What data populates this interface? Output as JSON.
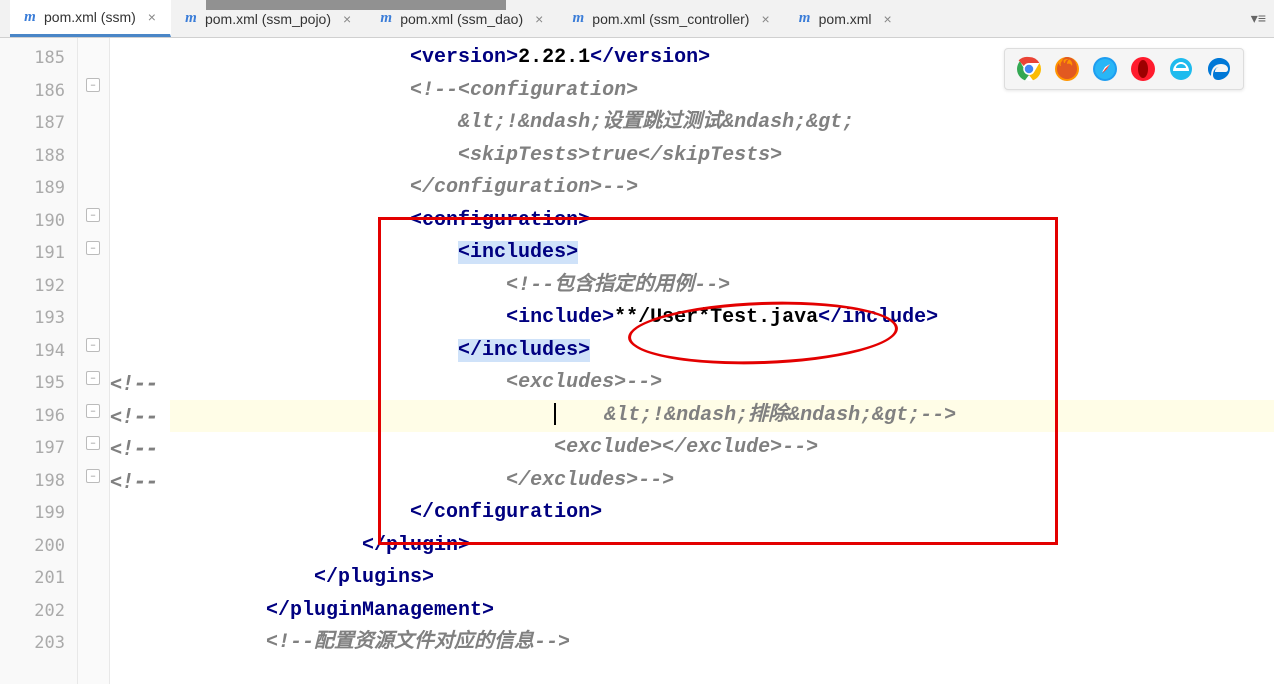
{
  "tabs": [
    {
      "label": "pom.xml (ssm)",
      "active": true
    },
    {
      "label": "pom.xml (ssm_pojo)",
      "active": false
    },
    {
      "label": "pom.xml (ssm_dao)",
      "active": false
    },
    {
      "label": "pom.xml (ssm_controller)",
      "active": false
    },
    {
      "label": "pom.xml",
      "active": false
    }
  ],
  "line_numbers": [
    "185",
    "186",
    "187",
    "188",
    "189",
    "190",
    "191",
    "192",
    "193",
    "194",
    "195",
    "196",
    "197",
    "198",
    "199",
    "200",
    "201",
    "202",
    "203"
  ],
  "comment_prefix": "<!--",
  "code": {
    "l185": {
      "indent": "                    ",
      "open": "<version>",
      "text": "2.22.1",
      "close": "</version>"
    },
    "l186": {
      "indent": "                    ",
      "cmt": "<!--<configuration>"
    },
    "l187": {
      "indent": "                        ",
      "cmt": "&lt;!&ndash;设置跳过测试&ndash;&gt;"
    },
    "l188": {
      "indent": "                        ",
      "cmt": "<skipTests>true</skipTests>"
    },
    "l189": {
      "indent": "                    ",
      "cmt": "</configuration>-->"
    },
    "l190": {
      "indent": "                    ",
      "tag": "<configuration>"
    },
    "l191": {
      "indent": "                        ",
      "tag": "<includes>"
    },
    "l192": {
      "indent": "                            ",
      "cmt": "<!--包含指定的用例-->"
    },
    "l193": {
      "indent": "                            ",
      "open": "<include>",
      "text": "**/User*Test.java",
      "close": "</include>"
    },
    "l194": {
      "indent": "                        ",
      "tag": "</includes>"
    },
    "l195": {
      "indent": "                            ",
      "cmt": "<excludes>-->"
    },
    "l196": {
      "indent": "                                ",
      "cmt": "&lt;!&ndash;排除&ndash;&gt;-->"
    },
    "l197": {
      "indent": "                                ",
      "cmt": "<exclude></exclude>-->"
    },
    "l198": {
      "indent": "                            ",
      "cmt": "</excludes>-->"
    },
    "l199": {
      "indent": "                    ",
      "tag": "</configuration>"
    },
    "l200": {
      "indent": "                ",
      "tag": "</plugin>"
    },
    "l201": {
      "indent": "            ",
      "tag": "</plugins>"
    },
    "l202": {
      "indent": "        ",
      "tag": "</pluginManagement>"
    },
    "l203": {
      "indent": "        ",
      "cmt": "<!--配置资源文件对应的信息-->"
    }
  },
  "browsers": [
    "chrome",
    "firefox",
    "safari",
    "opera",
    "ie",
    "edge"
  ]
}
